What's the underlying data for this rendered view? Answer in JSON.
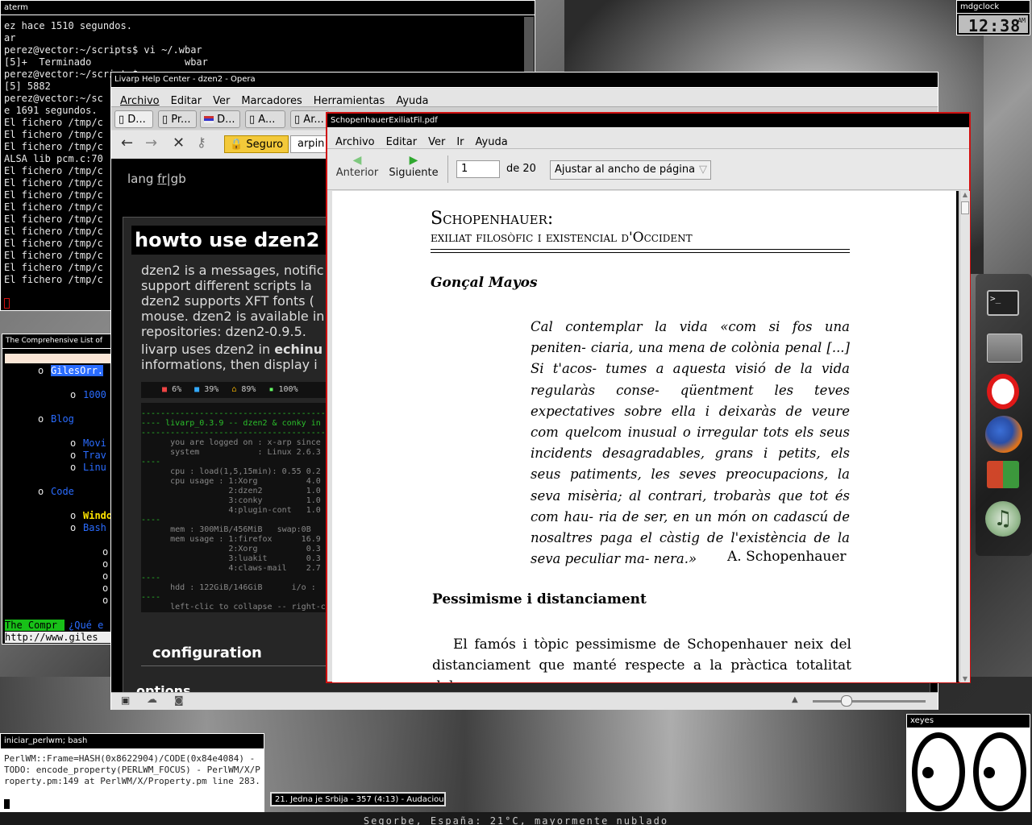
{
  "desktop": {
    "colors": {
      "background": "#2a2a2a",
      "accent_red": "#d01010"
    },
    "weather_text": "Segorbe, España: 21°C, mayormente nublado"
  },
  "clock": {
    "title": "mdgclock",
    "time": "12:38",
    "ampm": "AM"
  },
  "aterm": {
    "title": "aterm",
    "lines": [
      "ez hace 1510 segundos.",
      "ar",
      "perez@vector:~/scripts$ vi ~/.wbar",
      "[5]+  Terminado                wbar",
      "perez@vector:~/scripts$",
      "[5] 5882",
      "perez@vector:~/sc",
      "e 1691 segundos.",
      "El fichero /tmp/c",
      "El fichero /tmp/c",
      "El fichero /tmp/c",
      "ALSA lib pcm.c:70",
      "El fichero /tmp/c",
      "El fichero /tmp/c",
      "El fichero /tmp/c",
      "El fichero /tmp/c",
      "El fichero /tmp/c",
      "El fichero /tmp/c",
      "El fichero /tmp/c",
      "El fichero /tmp/c",
      "El fichero /tmp/c",
      "El fichero /tmp/c"
    ]
  },
  "lynx": {
    "title": "The Comprehensive List of",
    "items": [
      "GilesOrr.",
      "1000",
      "Blog",
      "Movi",
      "Trav",
      "Linu",
      "Code",
      "Windo",
      "Bash"
    ],
    "status_left": "The Compr",
    "status_right": "¿Qué e",
    "url": "http://www.giles"
  },
  "opera": {
    "title": "Livarp Help Center - dzen2 - Opera",
    "menu": [
      "Archivo",
      "Editar",
      "Ver",
      "Marcadores",
      "Herramientas",
      "Ayuda"
    ],
    "tabs": [
      "D...",
      "Pr...",
      "D...",
      "A...",
      "Ar..."
    ],
    "secure_label": "Seguro",
    "address": "arpin",
    "lang_prefix": "lang ",
    "lang_fr": "fr",
    "lang_sep": "|",
    "lang_gb": "gb",
    "heading": "howto use dzen2",
    "para1": "dzen2 is a messages, notific support different scripts la dzen2 supports XFT fonts ( mouse. dzen2 is available in repositories: dzen2-0.9.5.",
    "para2_a": "livarp uses dzen2 in ",
    "para2_b": "echinu",
    "para2_c": " informations, then display i",
    "dzen_bar": {
      "cpu": "6%",
      "mem": "39%",
      "home": "89%",
      "bat": "100%"
    },
    "conky_lines": [
      "----------------------------------------------",
      "---- livarp_0.3.9 -- dzen2 & conky in",
      "----------------------------------------------",
      "      you are logged on : x-arp since",
      "      system            : Linux 2.6.3",
      "----",
      "      cpu : load(1,5,15min): 0.55 0.2",
      "      cpu usage : 1:Xorg          4.0",
      "                  2:dzen2         1.0",
      "                  3:conky         1.0",
      "                  4:plugin-cont   1.0",
      "----",
      "      mem : 300MiB/456MiB   swap:0B",
      "      mem usage : 1:firefox      16.9",
      "                  2:Xorg          0.3",
      "                  3:luakit        0.3",
      "                  4:claws-mail    2.7",
      "----",
      "      hdd : 122GiB/146GiB      i/o :",
      "----",
      "      left-clic to collapse -- right-c"
    ],
    "section_configuration": "configuration",
    "section_options": "options"
  },
  "pdf": {
    "title": "SchopenhauerExiliatFil.pdf",
    "menu": [
      "Archivo",
      "Editar",
      "Ver",
      "Ir",
      "Ayuda"
    ],
    "prev_label": "Anterior",
    "next_label": "Siguiente",
    "page_value": "1",
    "page_total": "de 20",
    "zoom_option": "Ajustar al ancho de página",
    "doc_title_1": "Schopenhauer:",
    "doc_title_2": "exiliat filosòfic i existencial d'Occident",
    "doc_author": "Gonçal Mayos",
    "quote": "Cal contemplar la vida «com si fos una peniten- ciaria, una mena de colònia penal [...] Si t'acos- tumes a aquesta visió de la vida regularàs conse- qüentment les teves expectatives sobre ella i deixaràs de veure com quelcom inusual o irregular tots els seus incidents desagradables, grans i petits, els seus patiments, les seves preocupacions, la seva misèria; al contrari, trobaràs que tot és com hau- ria de ser, en un món on cadascú de nosaltres paga el càstig de l'existència de la seva peculiar ma- nera.»",
    "quote_attr": "A. Schopenhauer",
    "section_heading": "Pessimisme i distanciament",
    "body_text": "El famós i tòpic pessimisme de Schopenhauer neix del distanciament que manté respecte a la pràctica totalitat dels"
  },
  "bash": {
    "title": "iniciar_perlwm; bash",
    "text": "PerlWM::Frame=HASH(0x8622904)/CODE(0x84e4084) - TODO: encode_property(PERLWM_FOCUS) - PerlWM/X/Property.pm:149 at PerlWM/X/Property.pm line 283."
  },
  "xeyes": {
    "title": "xeyes"
  },
  "audacious": {
    "label": "21. Jedna je Srbija - 357 (4:13) - Audacious"
  },
  "dock": {
    "icons": [
      "terminal-icon",
      "folder-icon",
      "opera-icon",
      "firefox-icon",
      "windows-icon",
      "music-icon"
    ]
  }
}
